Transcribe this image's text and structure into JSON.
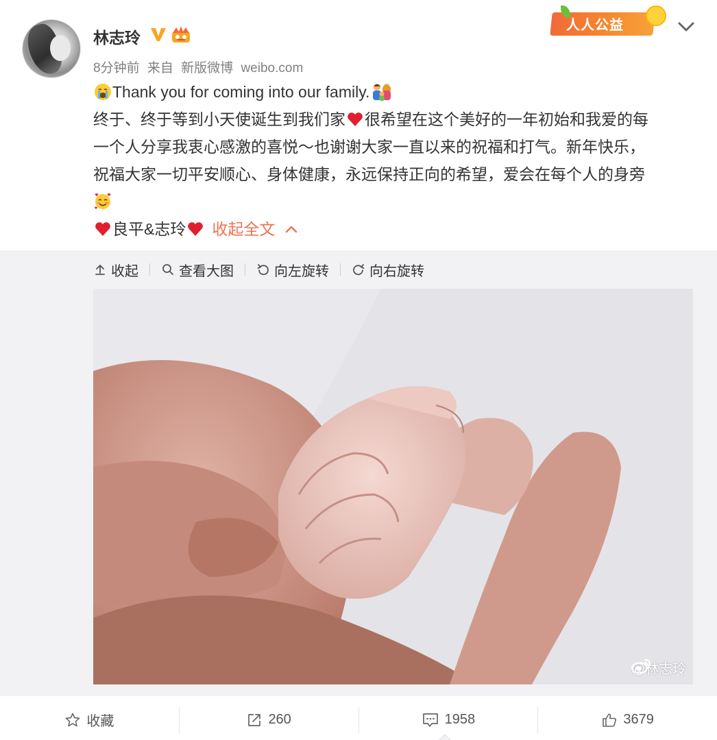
{
  "post": {
    "username": "林志玲",
    "time": "8分钟前",
    "source_prefix": "来自",
    "source_app": "新版微博",
    "source_site": "weibo.com",
    "charity_badge": "人人公益",
    "icons": [
      "verified-v-icon",
      "crown-icon",
      "more-chevron-icon"
    ]
  },
  "content": {
    "line1": "Thank you for coming into our family.",
    "line2a": "终于、终于等到小天使诞生到我们家",
    "line2b": "很希望在这个美好的一年初始和我爱的每",
    "line3": "一个人分享我衷心感激的喜悦～也谢谢大家一直以来的祝福和打气。新年快乐，",
    "line4": "祝福大家一切平安顺心、身体健康，永远保持正向的希望，爱会在每个人的身旁",
    "signature": "良平&志玲",
    "collapse_label": "收起全文",
    "emojis": [
      "crying-face",
      "family",
      "red-heart",
      "smiling-face-with-hearts"
    ]
  },
  "media": {
    "toolbar": {
      "collapse": "收起",
      "view_large": "查看大图",
      "rotate_left": "向左旋转",
      "rotate_right": "向右旋转"
    },
    "watermark": "@林志玲"
  },
  "actions": {
    "favorite": "收藏",
    "repost_count": "260",
    "comment_count": "1958",
    "like_count": "3679"
  },
  "colors": {
    "accent": "#eb7350",
    "text": "#333333",
    "meta": "#808080",
    "media_bg": "#f2f2f5",
    "verified": "#f5a623"
  }
}
